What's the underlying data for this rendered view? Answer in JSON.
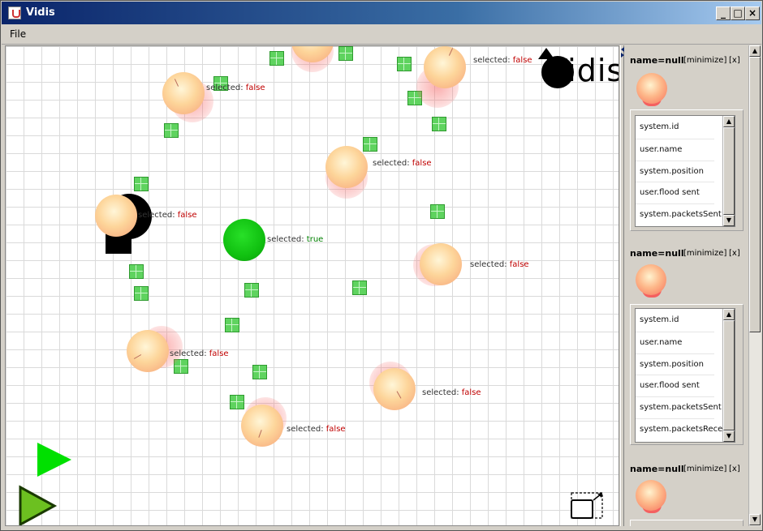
{
  "window": {
    "title": "Vidis"
  },
  "menubar": {
    "items": [
      "File"
    ]
  },
  "canvas": {
    "logo_text": "Vidis",
    "selected_key": "selected:",
    "nodes": [
      {
        "label_key": "selected:",
        "value": "false"
      },
      {
        "label_key": "selected:",
        "value": "false"
      },
      {
        "label_key": "selected:",
        "value": "false"
      },
      {
        "label_key": "selected:",
        "value": "false"
      },
      {
        "label_key": "selected:",
        "value": "true"
      },
      {
        "label_key": "selected:",
        "value": "false"
      },
      {
        "label_key": "selected:",
        "value": "false"
      },
      {
        "label_key": "selected:",
        "value": "false"
      },
      {
        "label_key": "selected:",
        "value": "false"
      }
    ]
  },
  "panels": [
    {
      "title": "name=null",
      "minimize_label": "[minimize]",
      "close_label": "[x]",
      "properties": [
        "system.id",
        "user.name",
        "system.position",
        "user.flood sent",
        "system.packetsSent"
      ]
    },
    {
      "title": "name=null",
      "minimize_label": "[minimize]",
      "close_label": "[x]",
      "properties": [
        "system.id",
        "user.name",
        "system.position",
        "user.flood sent",
        "system.packetsSent",
        "system.packetsReceiv"
      ]
    },
    {
      "title": "name=null",
      "minimize_label": "[minimize]",
      "close_label": "[x]"
    }
  ],
  "colors": {
    "false_value": "#c00000",
    "true_value": "#008000",
    "packet": "#5fd35f",
    "play_small": "#00e000",
    "play_large": "#6cc020"
  },
  "icons": {
    "window_controls": [
      "minimize-icon",
      "maximize-icon",
      "close-icon"
    ],
    "canvas_controls": [
      "play-icon",
      "play-large-icon",
      "fullscreen-icon"
    ]
  }
}
